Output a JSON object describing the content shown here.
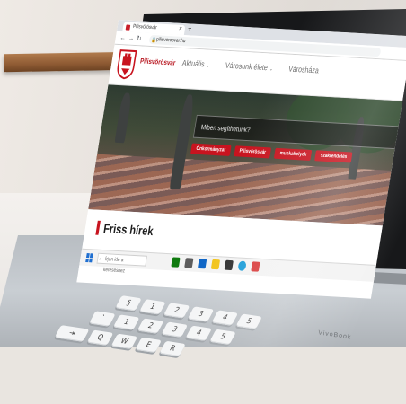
{
  "browser": {
    "tab_title": "Pilisvörösvár",
    "url": "pilisvorosvar.hu"
  },
  "site": {
    "name": "Pilisvörösvár",
    "menu": [
      {
        "label": "Aktuális"
      },
      {
        "label": "Városunk élete"
      },
      {
        "label": "Városháza"
      }
    ]
  },
  "hero": {
    "search_placeholder": "Miben segíthetünk?",
    "quick_links": [
      "Önkormányzat",
      "Pilisvörösvár",
      "munkahelyek",
      "szakrendelés"
    ]
  },
  "news": {
    "title": "Friss hírek"
  },
  "taskbar": {
    "search_placeholder": "Írjon ide a kereséshez"
  },
  "laptop": {
    "brand": "VivoBook"
  },
  "colors": {
    "brand_red": "#c8141f",
    "site_text": "#b7141e"
  }
}
